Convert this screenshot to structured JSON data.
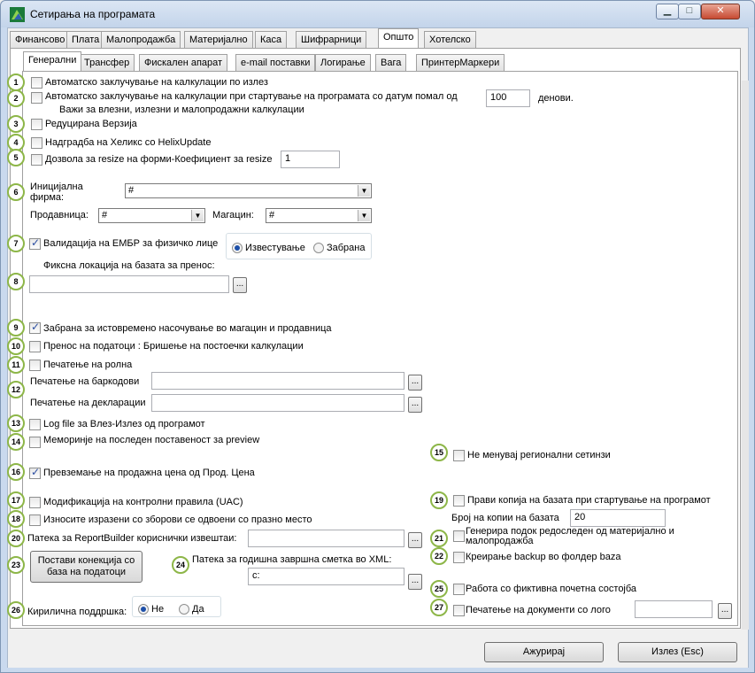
{
  "window": {
    "title": "Сетирања на програмата"
  },
  "main_tabs": [
    "Финансово",
    "Плата",
    "Малопродажба",
    "Материјално",
    "Каса",
    "Шифрарници",
    "Општо",
    "Хотелско"
  ],
  "sub_tabs": [
    "Генерални",
    "Трансфер",
    "Фискален апарат",
    "e-mail поставки",
    "Логирање",
    "Вага",
    "ПринтерМаркери"
  ],
  "badges": [
    "1",
    "2",
    "3",
    "4",
    "5",
    "6",
    "7",
    "8",
    "9",
    "10",
    "11",
    "12",
    "13",
    "14",
    "15",
    "16",
    "17",
    "18",
    "19",
    "20",
    "21",
    "22",
    "23",
    "24",
    "25",
    "26",
    "27"
  ],
  "settings": {
    "s1": "Автоматско заклучување на калкулации по излез",
    "s2": "Автоматско заклучување на калкулации при стартување на програмата со датум помал од",
    "s2_sub": "Важи за влезни, излезни и малопродажни калкулации",
    "s2_value": "100",
    "s2_unit": "денови.",
    "s3": "Редуцирана Верзија",
    "s4": "Надградба на Хеликс со HelixUpdate",
    "s5": "Дозвола за resize на форми-Коефициент за resize",
    "s5_value": "1",
    "s6_label": "Иницијална фирма:",
    "s6_value": "#",
    "prodavnica_label": "Продавница:",
    "prodavnica_value": "#",
    "magacin_label": "Магацин:",
    "magacin_value": "#",
    "s7": "Валидација на ЕМБР за физичко лице",
    "s7_radio1": "Известување",
    "s7_radio2": "Забрана",
    "s8_label": "Фиксна локација на базата за пренос:",
    "s8_value": "",
    "dots": "...",
    "s9": "Забрана за истовремено насочување во магацин и продавница",
    "s10": "Пренос на податоци : Бришење на постоечки калкулации",
    "s11": "Печатење на ролна",
    "s12_barcode": "Печатење на баркодови",
    "s12_barcode_value": "",
    "s12_declaration": "Печатење на декларации",
    "s12_declaration_value": "",
    "s13": "Log file за Влез-Излез од програмот",
    "s14": "Меморинје на последен поставеност за preview",
    "s15": "Не менувај регионални сетинзи",
    "s16": "Превземање на продажна цена од Прод. Цена",
    "s17": "Модификација на контролни правила (UAC)",
    "s18": "Износите изразени со зборови се одвоени со празно место",
    "s19": "Прави копија на базата при стартување на програмот",
    "s19_count_label": "Број на копии на базата",
    "s19_count_value": "20",
    "s20": "Патека за ReportBuilder кориснички извештаи:",
    "s20_value": "",
    "s21": "Генерира подок редоследен од материјално и малопродажба",
    "s22": "Креирање backup во фолдер baza",
    "s23": "Постави конекција со база на податоци",
    "s24": "Патека за годишна завршна сметка во XML:",
    "s24_value": "c:",
    "s25": "Работа со фиктивна почетна состојба",
    "s26_label": "Кирилична поддршка:",
    "s26_radio1": "Не",
    "s26_radio2": "Да",
    "s27": "Печатење на документи со лого",
    "s27_value": ""
  },
  "footer": {
    "save": "Ажурирај",
    "exit": "Излез (Esc)"
  },
  "colors": {
    "badge_border": "#8db648",
    "check": "#2b4ea1",
    "title_bg": "#c9d9ee"
  }
}
